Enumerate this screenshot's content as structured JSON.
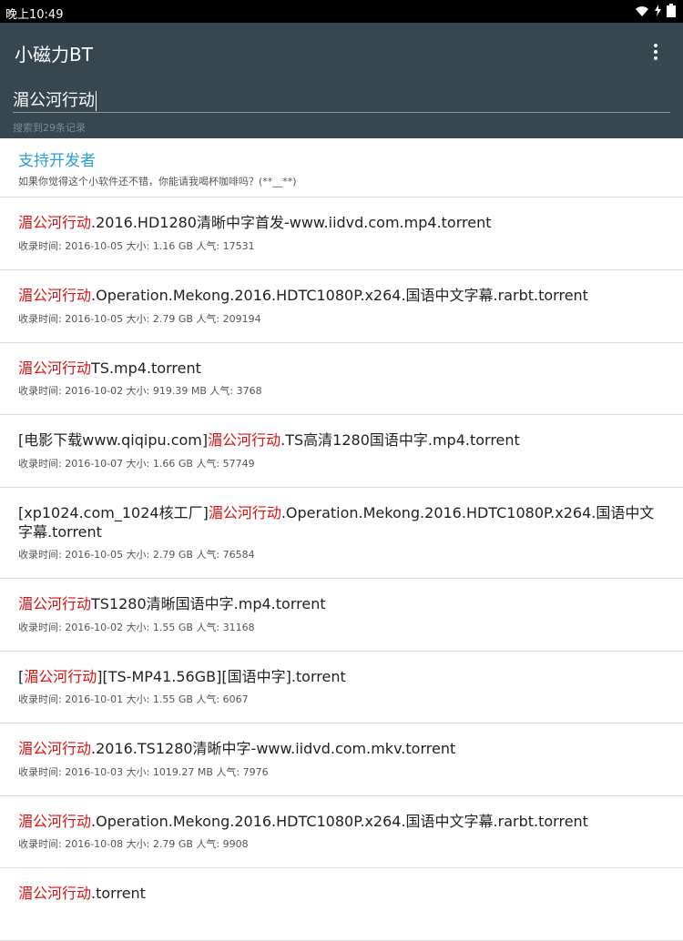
{
  "status_bar": {
    "time": "晚上10:49"
  },
  "app_bar": {
    "title": "小磁力BT",
    "search_value": "湄公河行动",
    "result_count": "搜索到29条记录",
    "menu_icon": "more-vert-icon"
  },
  "support": {
    "title": "支持开发者",
    "description": "如果你觉得这个小软件还不错，你能请我喝杯咖啡吗？(**__**)"
  },
  "labels": {
    "time": "收录时间:",
    "size": "大小:",
    "popularity": "人气:"
  },
  "colors": {
    "appbar": "#37474f",
    "highlight": "#e01010",
    "link": "#2a9fd6"
  },
  "results": [
    {
      "segments": [
        {
          "t": "湄公河行动",
          "hl": true
        },
        {
          "t": ".2016.HD1280清晰中字首发-www.iidvd.com.mp4.torrent",
          "hl": false
        }
      ],
      "date": "2016-10-05",
      "size": "1.16 GB",
      "popularity": "17531"
    },
    {
      "segments": [
        {
          "t": "湄公河行动",
          "hl": true
        },
        {
          "t": ".Operation.Mekong.2016.HDTC1080P.x264.国语中文字幕.rarbt.torrent",
          "hl": false
        }
      ],
      "date": "2016-10-05",
      "size": "2.79 GB",
      "popularity": "209194"
    },
    {
      "segments": [
        {
          "t": "湄公河行动",
          "hl": true
        },
        {
          "t": "TS.mp4.torrent",
          "hl": false
        }
      ],
      "date": "2016-10-02",
      "size": "919.39 MB",
      "popularity": "3768"
    },
    {
      "segments": [
        {
          "t": "[电影下载www.qiqipu.com]",
          "hl": false
        },
        {
          "t": "湄公河行动",
          "hl": true
        },
        {
          "t": ".TS高清1280国语中字.mp4.torrent",
          "hl": false
        }
      ],
      "date": "2016-10-07",
      "size": "1.66 GB",
      "popularity": "57749"
    },
    {
      "segments": [
        {
          "t": "[xp1024.com_1024核工厂]",
          "hl": false
        },
        {
          "t": "湄公河行动",
          "hl": true
        },
        {
          "t": ".Operation.Mekong.2016.HDTC1080P.x264.国语中文字幕.torrent",
          "hl": false
        }
      ],
      "date": "2016-10-05",
      "size": "2.79 GB",
      "popularity": "76584"
    },
    {
      "segments": [
        {
          "t": "湄公河行动",
          "hl": true
        },
        {
          "t": "TS1280清晰国语中字.mp4.torrent",
          "hl": false
        }
      ],
      "date": "2016-10-02",
      "size": "1.55 GB",
      "popularity": "31168"
    },
    {
      "segments": [
        {
          "t": "[",
          "hl": false
        },
        {
          "t": "湄公河行动",
          "hl": true
        },
        {
          "t": "][TS-MP41.56GB][国语中字].torrent",
          "hl": false
        }
      ],
      "date": "2016-10-01",
      "size": "1.55 GB",
      "popularity": "6067"
    },
    {
      "segments": [
        {
          "t": "湄公河行动",
          "hl": true
        },
        {
          "t": ".2016.TS1280清晰中字-www.iidvd.com.mkv.torrent",
          "hl": false
        }
      ],
      "date": "2016-10-03",
      "size": "1019.27 MB",
      "popularity": "7976"
    },
    {
      "segments": [
        {
          "t": "湄公河行动",
          "hl": true
        },
        {
          "t": ".Operation.Mekong.2016.HDTC1080P.x264.国语中文字幕.rarbt.torrent",
          "hl": false
        }
      ],
      "date": "2016-10-08",
      "size": "2.79 GB",
      "popularity": "9908"
    },
    {
      "segments": [
        {
          "t": "湄公河行动",
          "hl": true
        },
        {
          "t": ".torrent",
          "hl": false
        }
      ],
      "date": "",
      "size": "",
      "popularity": ""
    }
  ]
}
